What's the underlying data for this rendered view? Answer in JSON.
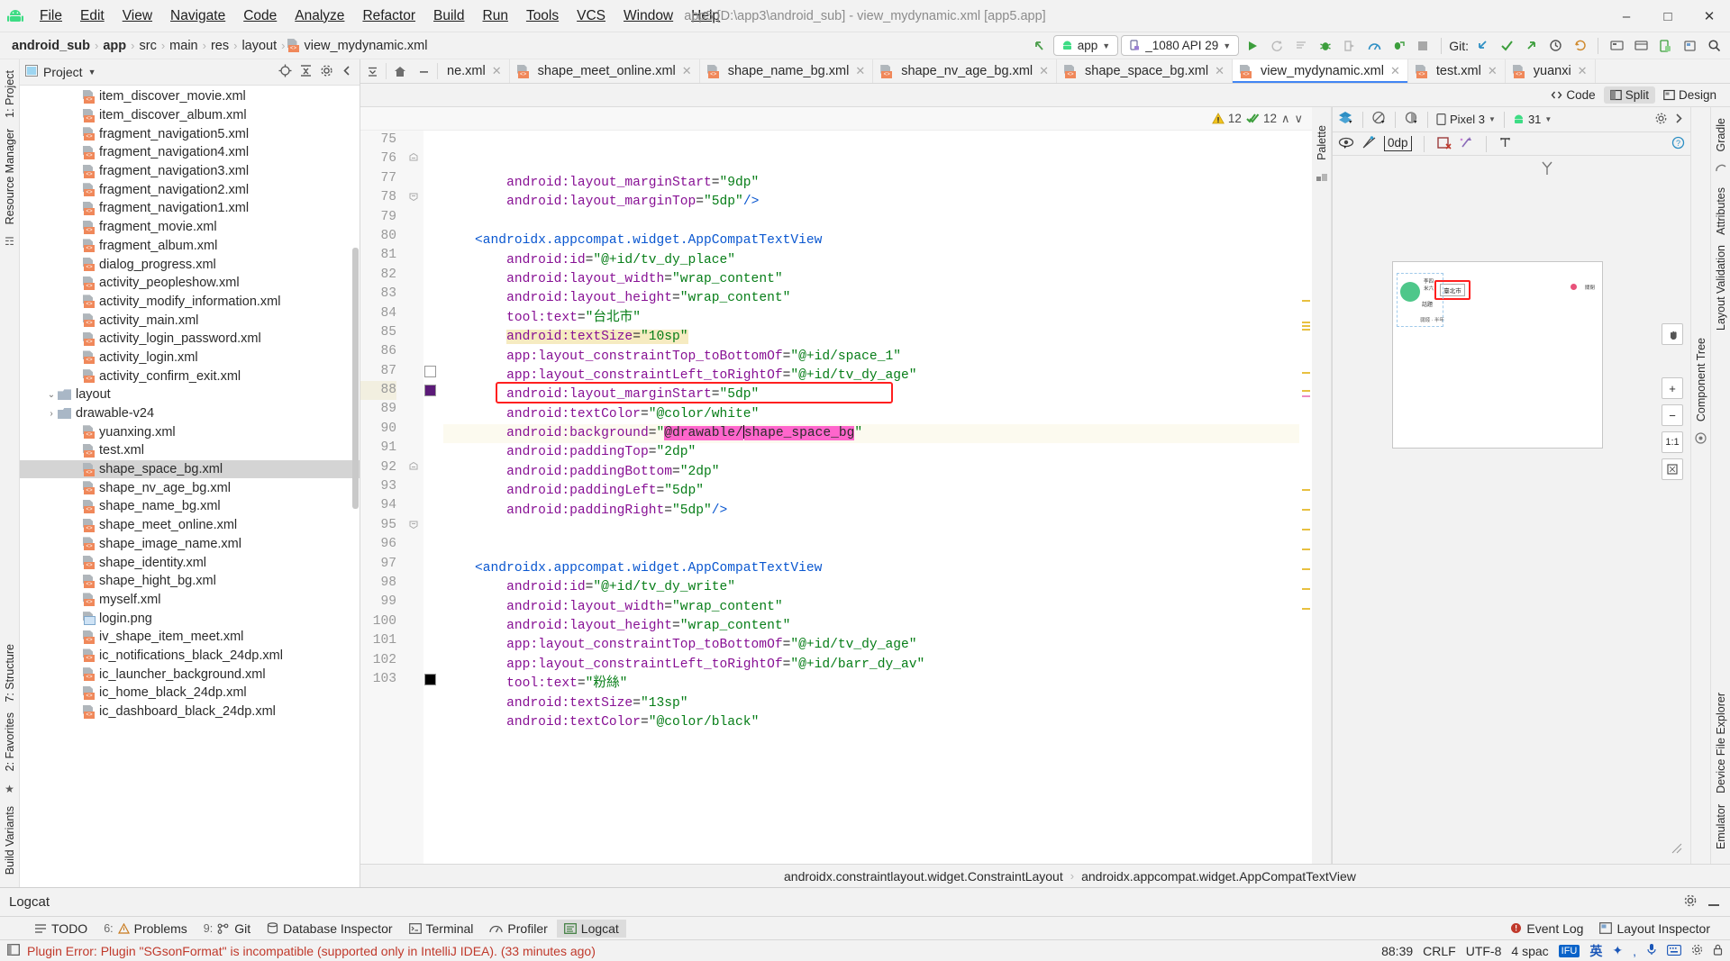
{
  "window": {
    "title": "app5 [D:\\app3\\android_sub] - view_mydynamic.xml [app5.app]",
    "minimize": "─",
    "maximize": "☐",
    "close": "✕"
  },
  "menu": [
    "File",
    "Edit",
    "View",
    "Navigate",
    "Code",
    "Analyze",
    "Refactor",
    "Build",
    "Run",
    "Tools",
    "VCS",
    "Window",
    "Help"
  ],
  "breadcrumb": {
    "items": [
      "android_sub",
      "app",
      "src",
      "main",
      "res",
      "layout",
      "view_mydynamic.xml"
    ],
    "separator": "›"
  },
  "toolbar": {
    "module_label": "app",
    "device_label": "_1080 API 29",
    "git_label": "Git:",
    "run_icon": "run-icon",
    "debug_icon": "debug-icon",
    "search_icon": "search-icon"
  },
  "left_strips": {
    "project": "1: Project",
    "resource_manager": "Resource Manager",
    "structure": "7: Structure",
    "favorites": "2: Favorites",
    "build_variants": "Build Variants"
  },
  "right_strips": {
    "gradle": "Gradle",
    "layout_validation": "Layout Validation",
    "attributes": "Attributes",
    "device_file_explorer": "Device File Explorer",
    "emulator": "Emulator",
    "component_tree": "Component Tree",
    "palette": "Palette"
  },
  "project_panel": {
    "title": "Project",
    "tree": [
      {
        "label": "ic_dashboard_black_24dp.xml",
        "indent": 5,
        "type": "xml",
        "selected": false
      },
      {
        "label": "ic_home_black_24dp.xml",
        "indent": 5,
        "type": "xml",
        "selected": false
      },
      {
        "label": "ic_launcher_background.xml",
        "indent": 5,
        "type": "xml",
        "selected": false
      },
      {
        "label": "ic_notifications_black_24dp.xml",
        "indent": 5,
        "type": "xml",
        "selected": false
      },
      {
        "label": "iv_shape_item_meet.xml",
        "indent": 5,
        "type": "xml",
        "selected": false
      },
      {
        "label": "login.png",
        "indent": 5,
        "type": "png",
        "selected": false
      },
      {
        "label": "myself.xml",
        "indent": 5,
        "type": "xml",
        "selected": false
      },
      {
        "label": "shape_hight_bg.xml",
        "indent": 5,
        "type": "xml",
        "selected": false
      },
      {
        "label": "shape_identity.xml",
        "indent": 5,
        "type": "xml",
        "selected": false
      },
      {
        "label": "shape_image_name.xml",
        "indent": 5,
        "type": "xml",
        "selected": false
      },
      {
        "label": "shape_meet_online.xml",
        "indent": 5,
        "type": "xml",
        "selected": false
      },
      {
        "label": "shape_name_bg.xml",
        "indent": 5,
        "type": "xml",
        "selected": false
      },
      {
        "label": "shape_nv_age_bg.xml",
        "indent": 5,
        "type": "xml",
        "selected": false
      },
      {
        "label": "shape_space_bg.xml",
        "indent": 5,
        "type": "xml",
        "selected": true
      },
      {
        "label": "test.xml",
        "indent": 5,
        "type": "xml",
        "selected": false
      },
      {
        "label": "yuanxing.xml",
        "indent": 5,
        "type": "xml",
        "selected": false
      },
      {
        "label": "drawable-v24",
        "indent": 3,
        "type": "folder",
        "twisty": "›",
        "selected": false
      },
      {
        "label": "layout",
        "indent": 3,
        "type": "folder",
        "twisty": "⌄",
        "selected": false
      },
      {
        "label": "activity_confirm_exit.xml",
        "indent": 5,
        "type": "xml",
        "selected": false
      },
      {
        "label": "activity_login.xml",
        "indent": 5,
        "type": "xml",
        "selected": false
      },
      {
        "label": "activity_login_password.xml",
        "indent": 5,
        "type": "xml",
        "selected": false
      },
      {
        "label": "activity_main.xml",
        "indent": 5,
        "type": "xml",
        "selected": false
      },
      {
        "label": "activity_modify_information.xml",
        "indent": 5,
        "type": "xml",
        "selected": false
      },
      {
        "label": "activity_peopleshow.xml",
        "indent": 5,
        "type": "xml",
        "selected": false
      },
      {
        "label": "dialog_progress.xml",
        "indent": 5,
        "type": "xml",
        "selected": false
      },
      {
        "label": "fragment_album.xml",
        "indent": 5,
        "type": "xml",
        "selected": false
      },
      {
        "label": "fragment_movie.xml",
        "indent": 5,
        "type": "xml",
        "selected": false
      },
      {
        "label": "fragment_navigation1.xml",
        "indent": 5,
        "type": "xml",
        "selected": false
      },
      {
        "label": "fragment_navigation2.xml",
        "indent": 5,
        "type": "xml",
        "selected": false
      },
      {
        "label": "fragment_navigation3.xml",
        "indent": 5,
        "type": "xml",
        "selected": false
      },
      {
        "label": "fragment_navigation4.xml",
        "indent": 5,
        "type": "xml",
        "selected": false
      },
      {
        "label": "fragment_navigation5.xml",
        "indent": 5,
        "type": "xml",
        "selected": false
      },
      {
        "label": "item_discover_album.xml",
        "indent": 5,
        "type": "xml",
        "selected": false
      },
      {
        "label": "item_discover_movie.xml",
        "indent": 5,
        "type": "xml",
        "selected": false
      }
    ]
  },
  "editor_tabs": [
    {
      "label": "ne.xml",
      "active": false,
      "clipped": true
    },
    {
      "label": "shape_meet_online.xml",
      "active": false
    },
    {
      "label": "shape_name_bg.xml",
      "active": false
    },
    {
      "label": "shape_nv_age_bg.xml",
      "active": false
    },
    {
      "label": "shape_space_bg.xml",
      "active": false
    },
    {
      "label": "view_mydynamic.xml",
      "active": true
    },
    {
      "label": "test.xml",
      "active": false
    },
    {
      "label": "yuanxi",
      "active": false,
      "clipped": true
    }
  ],
  "view_modes": [
    {
      "label": "Code",
      "active": false,
      "icon": "code-icon"
    },
    {
      "label": "Split",
      "active": true,
      "icon": "split-icon"
    },
    {
      "label": "Design",
      "active": false,
      "icon": "design-icon"
    }
  ],
  "inspections": {
    "warning_count": "12",
    "ok_count": "12",
    "up_arrow": "∧",
    "down_arrow": "∨"
  },
  "code": {
    "first_line_number": 75,
    "lines": [
      {
        "n": 75,
        "indent": 8,
        "tokens": [
          {
            "t": "android:layout_marginStart",
            "c": "attr"
          },
          {
            "t": "=",
            "c": "punc"
          },
          {
            "t": "\"9dp\"",
            "c": "str"
          }
        ]
      },
      {
        "n": 76,
        "indent": 8,
        "fold": "end",
        "tokens": [
          {
            "t": "android:layout_marginTop",
            "c": "attr"
          },
          {
            "t": "=",
            "c": "punc"
          },
          {
            "t": "\"5dp\"",
            "c": "str"
          },
          {
            "t": "/>",
            "c": "tag"
          }
        ]
      },
      {
        "n": 77,
        "indent": 0,
        "tokens": []
      },
      {
        "n": 78,
        "indent": 4,
        "fold": "start",
        "tokens": [
          {
            "t": "<androidx.appcompat.widget.AppCompatTextView",
            "c": "tag"
          }
        ]
      },
      {
        "n": 79,
        "indent": 8,
        "tokens": [
          {
            "t": "android:id",
            "c": "attr"
          },
          {
            "t": "=",
            "c": "punc"
          },
          {
            "t": "\"@+id/tv_dy_place\"",
            "c": "str"
          }
        ]
      },
      {
        "n": 80,
        "indent": 8,
        "tokens": [
          {
            "t": "android:layout_width",
            "c": "attr"
          },
          {
            "t": "=",
            "c": "punc"
          },
          {
            "t": "\"wrap_content\"",
            "c": "str"
          }
        ]
      },
      {
        "n": 81,
        "indent": 8,
        "tokens": [
          {
            "t": "android:layout_height",
            "c": "attr"
          },
          {
            "t": "=",
            "c": "punc"
          },
          {
            "t": "\"wrap_content\"",
            "c": "str"
          }
        ]
      },
      {
        "n": 82,
        "indent": 8,
        "tokens": [
          {
            "t": "tool:text",
            "c": "attr"
          },
          {
            "t": "=",
            "c": "punc"
          },
          {
            "t": "\"台北市\"",
            "c": "str"
          }
        ]
      },
      {
        "n": 83,
        "indent": 8,
        "highlight": "yellow",
        "tokens": [
          {
            "t": "android:textSize",
            "c": "attr"
          },
          {
            "t": "=",
            "c": "punc"
          },
          {
            "t": "\"10sp\"",
            "c": "str"
          }
        ]
      },
      {
        "n": 84,
        "indent": 8,
        "tokens": [
          {
            "t": "app:layout_constraintTop_toBottomOf",
            "c": "attr"
          },
          {
            "t": "=",
            "c": "punc"
          },
          {
            "t": "\"@+id/space_1\"",
            "c": "str"
          }
        ]
      },
      {
        "n": 85,
        "indent": 8,
        "tokens": [
          {
            "t": "app:layout_constraintLeft_toRightOf",
            "c": "attr"
          },
          {
            "t": "=",
            "c": "punc"
          },
          {
            "t": "\"@+id/tv_dy_age\"",
            "c": "str"
          }
        ]
      },
      {
        "n": 86,
        "indent": 8,
        "tokens": [
          {
            "t": "android:layout_marginStart",
            "c": "attr"
          },
          {
            "t": "=",
            "c": "punc"
          },
          {
            "t": "\"5dp\"",
            "c": "str"
          }
        ]
      },
      {
        "n": 87,
        "indent": 8,
        "chip": "#ffffff",
        "tokens": [
          {
            "t": "android:textColor",
            "c": "attr"
          },
          {
            "t": "=",
            "c": "punc"
          },
          {
            "t": "\"@color/white\"",
            "c": "str"
          }
        ]
      },
      {
        "n": 88,
        "indent": 8,
        "chip": "#5b1a78",
        "highlight": "line",
        "redbox": true,
        "tokens": [
          {
            "t": "android:background",
            "c": "attr"
          },
          {
            "t": "=",
            "c": "punc"
          },
          {
            "t": "\"",
            "c": "str"
          },
          {
            "t": "@drawable/",
            "c": "sel"
          },
          {
            "t": "caret",
            "c": "caret"
          },
          {
            "t": "shape_space_bg",
            "c": "sel"
          },
          {
            "t": "\"",
            "c": "str"
          }
        ]
      },
      {
        "n": 89,
        "indent": 8,
        "tokens": [
          {
            "t": "android:paddingTop",
            "c": "attr"
          },
          {
            "t": "=",
            "c": "punc"
          },
          {
            "t": "\"2dp\"",
            "c": "str"
          }
        ]
      },
      {
        "n": 90,
        "indent": 8,
        "tokens": [
          {
            "t": "android:paddingBottom",
            "c": "attr"
          },
          {
            "t": "=",
            "c": "punc"
          },
          {
            "t": "\"2dp\"",
            "c": "str"
          }
        ]
      },
      {
        "n": 91,
        "indent": 8,
        "tokens": [
          {
            "t": "android:paddingLeft",
            "c": "attr"
          },
          {
            "t": "=",
            "c": "punc"
          },
          {
            "t": "\"5dp\"",
            "c": "str"
          }
        ]
      },
      {
        "n": 92,
        "indent": 8,
        "fold": "end",
        "tokens": [
          {
            "t": "android:paddingRight",
            "c": "attr"
          },
          {
            "t": "=",
            "c": "punc"
          },
          {
            "t": "\"5dp\"",
            "c": "str"
          },
          {
            "t": "/>",
            "c": "tag"
          }
        ]
      },
      {
        "n": 93,
        "indent": 0,
        "tokens": []
      },
      {
        "n": 94,
        "indent": 0,
        "tokens": []
      },
      {
        "n": 95,
        "indent": 4,
        "fold": "start",
        "tokens": [
          {
            "t": "<androidx.appcompat.widget.AppCompatTextView",
            "c": "tag"
          }
        ]
      },
      {
        "n": 96,
        "indent": 8,
        "tokens": [
          {
            "t": "android:id",
            "c": "attr"
          },
          {
            "t": "=",
            "c": "punc"
          },
          {
            "t": "\"@+id/tv_dy_write\"",
            "c": "str"
          }
        ]
      },
      {
        "n": 97,
        "indent": 8,
        "tokens": [
          {
            "t": "android:layout_width",
            "c": "attr"
          },
          {
            "t": "=",
            "c": "punc"
          },
          {
            "t": "\"wrap_content\"",
            "c": "str"
          }
        ]
      },
      {
        "n": 98,
        "indent": 8,
        "tokens": [
          {
            "t": "android:layout_height",
            "c": "attr"
          },
          {
            "t": "=",
            "c": "punc"
          },
          {
            "t": "\"wrap_content\"",
            "c": "str"
          }
        ]
      },
      {
        "n": 99,
        "indent": 8,
        "tokens": [
          {
            "t": "app:layout_constraintTop_toBottomOf",
            "c": "attr"
          },
          {
            "t": "=",
            "c": "punc"
          },
          {
            "t": "\"@+id/tv_dy_age\"",
            "c": "str"
          }
        ]
      },
      {
        "n": 100,
        "indent": 8,
        "tokens": [
          {
            "t": "app:layout_constraintLeft_toRightOf",
            "c": "attr"
          },
          {
            "t": "=",
            "c": "punc"
          },
          {
            "t": "\"@+id/barr_dy_av\"",
            "c": "str"
          }
        ]
      },
      {
        "n": 101,
        "indent": 8,
        "tokens": [
          {
            "t": "tool:text",
            "c": "attr"
          },
          {
            "t": "=",
            "c": "punc"
          },
          {
            "t": "\"粉絲\"",
            "c": "str"
          }
        ]
      },
      {
        "n": 102,
        "indent": 8,
        "tokens": [
          {
            "t": "android:textSize",
            "c": "attr"
          },
          {
            "t": "=",
            "c": "punc"
          },
          {
            "t": "\"13sp\"",
            "c": "str"
          }
        ]
      },
      {
        "n": 103,
        "indent": 8,
        "chip": "#000000",
        "tokens": [
          {
            "t": "android:textColor",
            "c": "attr"
          },
          {
            "t": "=",
            "c": "punc"
          },
          {
            "t": "\"@color/black\"",
            "c": "str"
          }
        ]
      }
    ]
  },
  "preview": {
    "device_label": "Pixel 3",
    "api_label": "31",
    "margin_value": "0dp",
    "zoom_buttons": [
      "pan-icon",
      "+",
      "−",
      "1:1",
      "fit-icon"
    ],
    "phone_items": {
      "badge_text": "臺北市",
      "label1": "話題",
      "label2": "弱錢 · 半年",
      "right_label": "關閉"
    }
  },
  "component_path": {
    "parent": "androidx.constraintlayout.widget.ConstraintLayout",
    "child": "androidx.appcompat.widget.AppCompatTextView",
    "separator": "›"
  },
  "logcat": {
    "title": "Logcat",
    "settings_icon": "gear-icon",
    "minimize_icon": "minimize-icon"
  },
  "tool_windows": [
    {
      "num": "",
      "label": "TODO",
      "icon": "todo-icon",
      "active": false
    },
    {
      "num": "6:",
      "label": "Problems",
      "icon": "problems-icon",
      "active": false
    },
    {
      "num": "9:",
      "label": "Git",
      "icon": "git-icon",
      "active": false
    },
    {
      "num": "",
      "label": "Database Inspector",
      "icon": "db-icon",
      "active": false
    },
    {
      "num": "",
      "label": "Terminal",
      "icon": "terminal-icon",
      "active": false
    },
    {
      "num": "",
      "label": "Profiler",
      "icon": "profiler-icon",
      "active": false
    },
    {
      "num": "",
      "label": "Logcat",
      "icon": "logcat-icon",
      "active": true
    }
  ],
  "tool_windows_right": [
    {
      "label": "Event Log",
      "icon": "event-log-icon"
    },
    {
      "label": "Layout Inspector",
      "icon": "layout-inspector-icon"
    }
  ],
  "status_bar": {
    "message": "Plugin Error: Plugin \"SGsonFormat\" is incompatible (supported only in IntelliJ IDEA). (33 minutes ago)",
    "caret_position": "88:39",
    "line_separator": "CRLF",
    "encoding": "UTF-8",
    "indent": "4 spac",
    "ime_label": "英",
    "ime_badge": "IFU"
  },
  "colors": {
    "accent_blue": "#4286f4",
    "selection_pink": "#ff66cc",
    "highlight_yellow": "#f6ebc1",
    "red_box": "#ff1f1f",
    "android_green": "#3ddc84",
    "attr_purple": "#871094",
    "value_green": "#067d17",
    "name_blue": "#0a57d0",
    "error_red": "#c0392b"
  }
}
